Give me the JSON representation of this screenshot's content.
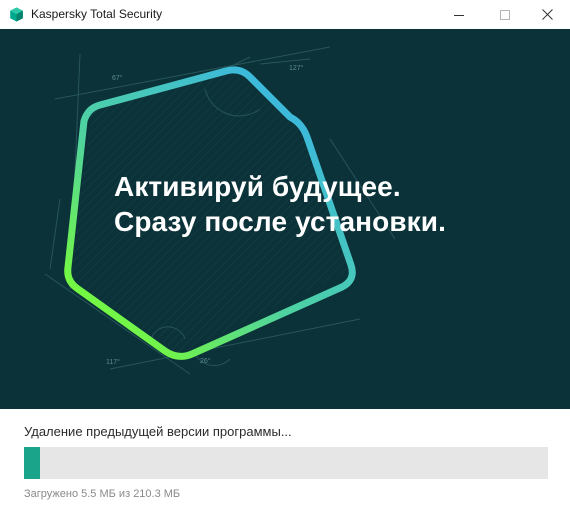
{
  "window": {
    "title": "Kaspersky Total Security"
  },
  "title_bar": {
    "app_icon": "kaspersky-shield-icon",
    "controls": {
      "minimize": "minimize-icon",
      "maximize": "maximize-icon",
      "close": "close-icon"
    }
  },
  "banner": {
    "headline_line1": "Активируй будущее.",
    "headline_line2": "Сразу после установки.",
    "angle_labels": [
      "67°",
      "127°",
      "117°",
      "26°"
    ],
    "colors": {
      "background": "#0a3238",
      "gradient_start": "#3ab6e3",
      "gradient_end": "#7dff2e"
    }
  },
  "status": {
    "label": "Удаление предыдущей версии программы...",
    "progress_fraction": 0.03,
    "progress_color": "#1aa58a",
    "download_prefix": "Загружено",
    "downloaded": "5.5 МБ",
    "of_word": "из",
    "total": "210.3 МБ"
  }
}
